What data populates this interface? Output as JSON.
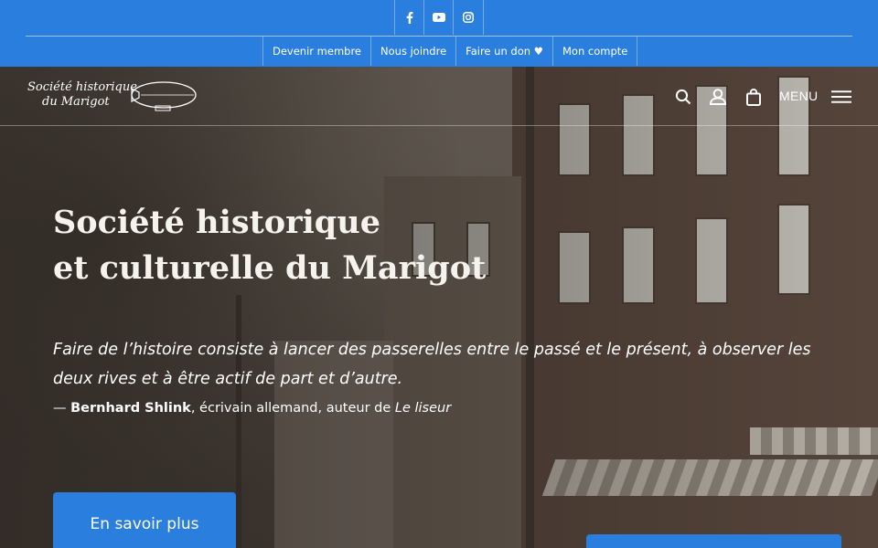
{
  "colors": {
    "accent": "#2a7fde",
    "text": "#ffffff"
  },
  "social": [
    {
      "name": "facebook-icon"
    },
    {
      "name": "youtube-icon"
    },
    {
      "name": "instagram-icon"
    }
  ],
  "secondary_nav": [
    "Devenir membre",
    "Nous joindre",
    "Faire un don ♥",
    "Mon compte"
  ],
  "logo": {
    "line1": "Société historique",
    "line2": "du Marigot"
  },
  "header": {
    "menu_label": "MENU",
    "icons": [
      "search-icon",
      "account-icon",
      "cart-icon",
      "hamburger-icon"
    ]
  },
  "hero": {
    "title_line1": "Société historique",
    "title_line2": "et culturelle du Marigot",
    "quote": "Faire de l’histoire consiste à lancer des passerelles entre le passé et le présent, à observer les deux rives et à être actif de part et d’autre.",
    "attribution": {
      "dash": "— ",
      "author": "Bernhard Shlink",
      "description": ", écrivain allemand, auteur de ",
      "book": "Le liseur"
    },
    "cta_label": "En savoir plus"
  }
}
